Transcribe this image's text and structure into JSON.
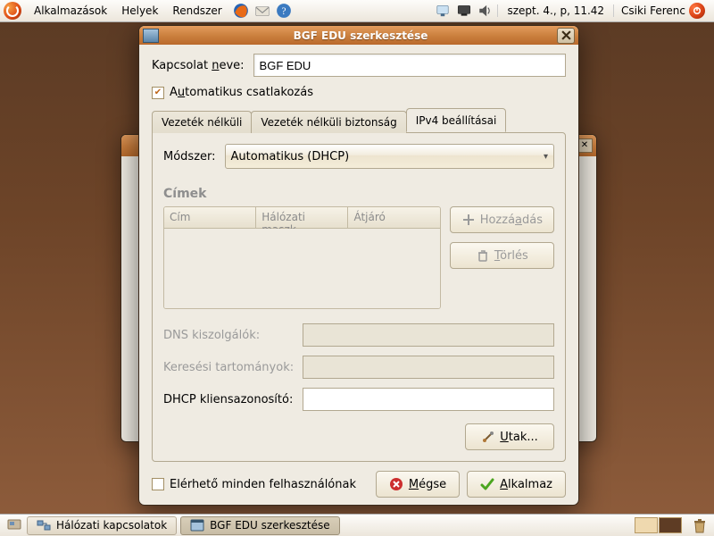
{
  "panel": {
    "menus": [
      "Alkalmazások",
      "Helyek",
      "Rendszer"
    ],
    "clock": "szept.  4., p, 11.42",
    "user": "Csiki Ferenc"
  },
  "taskbar": {
    "items": [
      {
        "label": "Hálózati kapcsolatok",
        "active": false
      },
      {
        "label": "BGF EDU szerkesztése",
        "active": true
      }
    ]
  },
  "dialog": {
    "title": "BGF EDU szerkesztése",
    "name_label": "Kapcsolat neve:",
    "name_value": "BGF EDU",
    "autoconnect": "Automatikus csatlakozás",
    "tabs": [
      "Vezeték nélküli",
      "Vezeték nélküli biztonság",
      "IPv4 beállításai"
    ],
    "method_label": "Módszer:",
    "method_value": "Automatikus (DHCP)",
    "addresses_title": "Címek",
    "addr_cols": [
      "Cím",
      "Hálózati maszk",
      "Átjáró"
    ],
    "add_btn": "Hozzáadás",
    "del_btn": "Törlés",
    "dns_label": "DNS kiszolgálók:",
    "search_label": "Keresési tartományok:",
    "dhcp_id_label": "DHCP kliensazonosító:",
    "routes_btn": "Utak...",
    "available_all": "Elérhető minden felhasználónak",
    "cancel": "Mégse",
    "apply": "Alkalmaz"
  }
}
